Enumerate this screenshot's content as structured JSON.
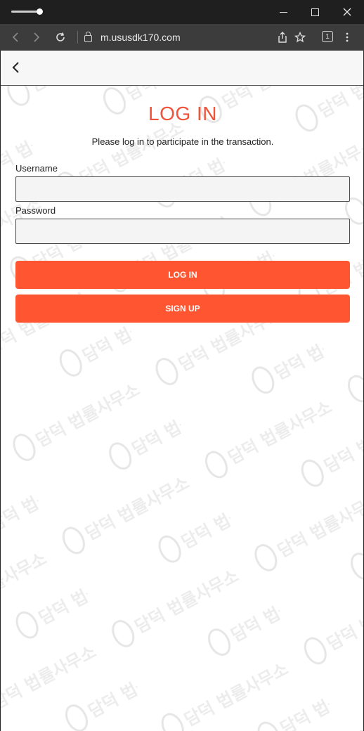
{
  "browser": {
    "url": "m.ususdk170.com",
    "tab_count": "1"
  },
  "page": {
    "title": "LOG IN",
    "subtitle": "Please log in to participate in the transaction.",
    "username_label": "Username",
    "username_value": "",
    "password_label": "Password",
    "password_value": "",
    "login_button": "LOG IN",
    "signup_button": "SIGN UP"
  },
  "watermark_text": "담덕 법률사무소",
  "colors": {
    "accent": "#ff5530",
    "title": "#f0533a"
  }
}
